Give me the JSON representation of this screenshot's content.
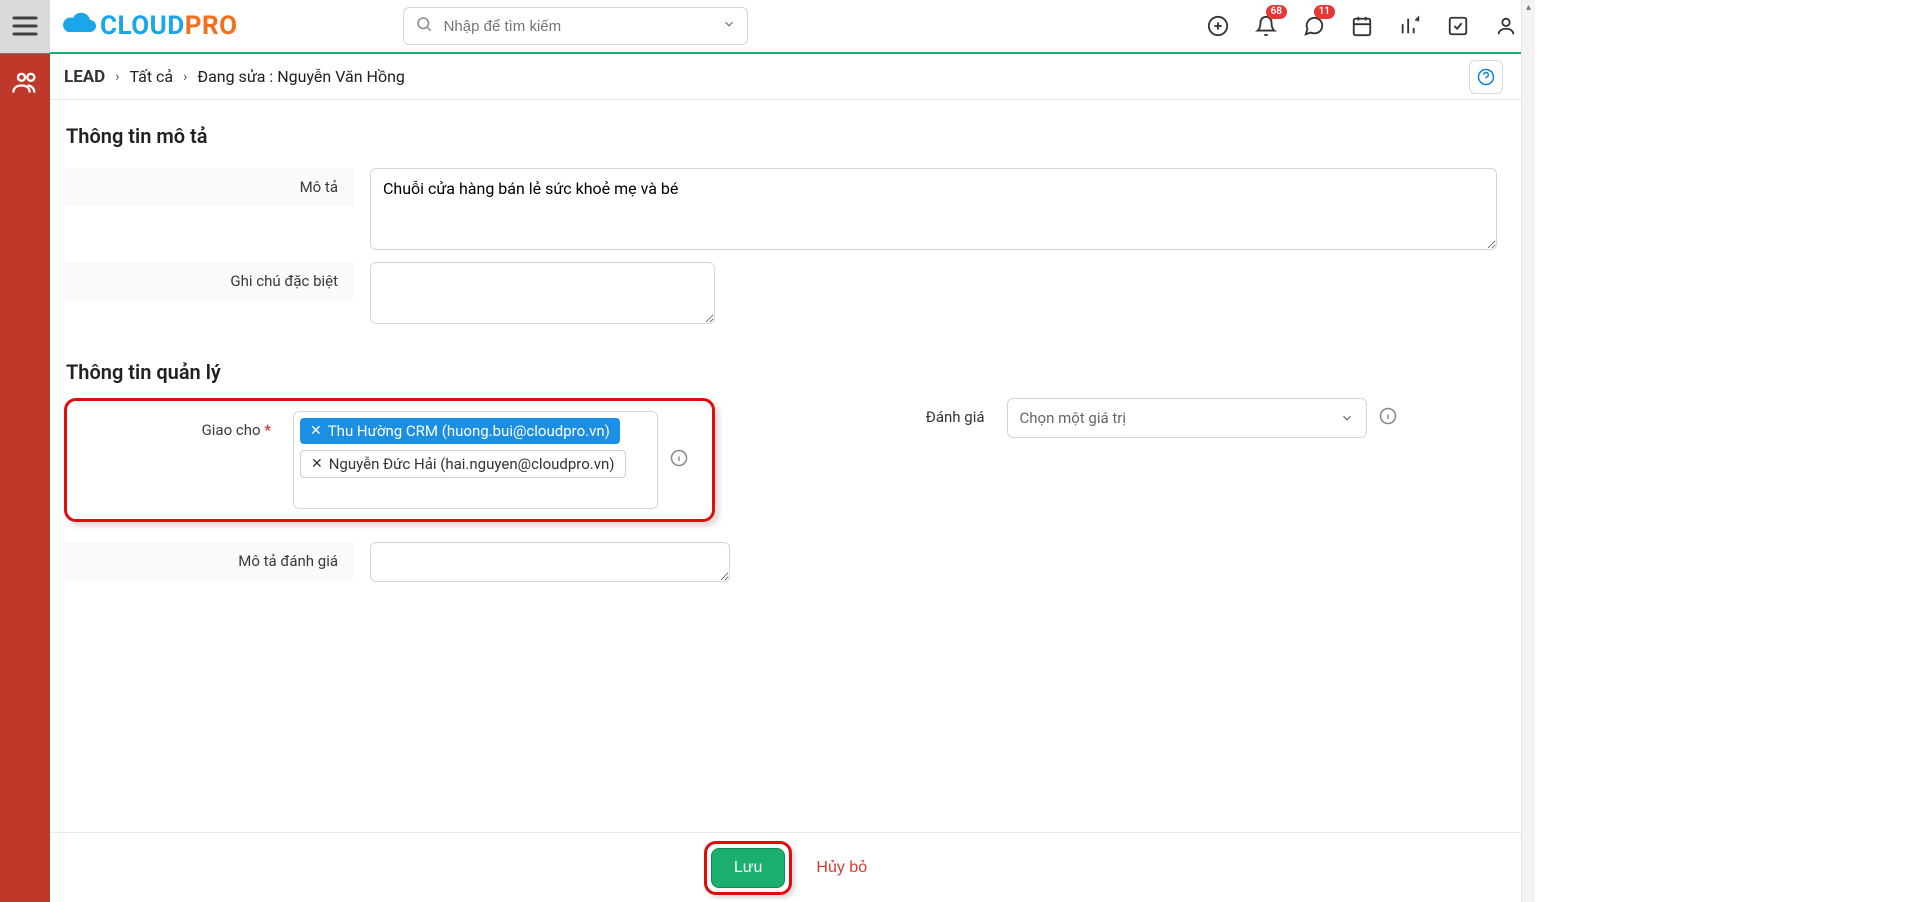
{
  "header": {
    "search_placeholder": "Nhập để tìm kiếm",
    "badges": {
      "bell": "68",
      "chat": "11"
    }
  },
  "breadcrumb": {
    "root": "LEAD",
    "level1": "Tất cả",
    "level2": "Đang sửa : Nguyễn Văn Hồng"
  },
  "sections": {
    "desc_title": "Thông tin mô tả",
    "mgmt_title": "Thông tin quản lý"
  },
  "labels": {
    "description": "Mô tả",
    "special_note": "Ghi chú đặc biệt",
    "assign_to": "Giao cho",
    "rating": "Đánh giá",
    "rating_desc": "Mô tả đánh giá"
  },
  "fields": {
    "description_value": "Chuỗi cửa hàng bán lẻ sức khoẻ mẹ và bé",
    "assignees": [
      {
        "label": "Thu Hường CRM (huong.bui@cloudpro.vn)",
        "selected": true
      },
      {
        "label": "Nguyễn Đức Hải (hai.nguyen@cloudpro.vn)",
        "selected": false
      }
    ],
    "rating_placeholder": "Chọn một giá trị"
  },
  "footer": {
    "save": "Lưu",
    "cancel": "Hủy bỏ"
  }
}
